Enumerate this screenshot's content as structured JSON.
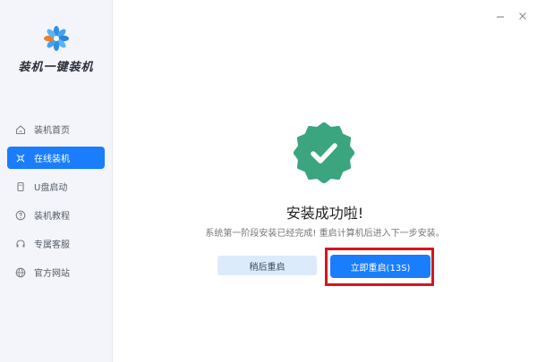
{
  "app": {
    "name": "装机一键装机",
    "brand_color": "#1a7dfb",
    "success_color": "#3aa57f",
    "highlight_color": "#d8141d"
  },
  "window_controls": {
    "minimize_icon": "minimize-icon",
    "close_icon": "close-icon"
  },
  "sidebar": {
    "items": [
      {
        "label": "装机首页",
        "icon": "home-icon",
        "active": false
      },
      {
        "label": "在线装机",
        "icon": "online-install-icon",
        "active": true
      },
      {
        "label": "U盘启动",
        "icon": "usb-icon",
        "active": false
      },
      {
        "label": "装机教程",
        "icon": "help-icon",
        "active": false
      },
      {
        "label": "专属客服",
        "icon": "headset-icon",
        "active": false
      },
      {
        "label": "官方网站",
        "icon": "globe-icon",
        "active": false
      }
    ]
  },
  "main": {
    "status_icon": "success-check-icon",
    "title": "安装成功啦!",
    "subtitle": "系统第一阶段安装已经完成! 重启计算机后进入下一步安装。",
    "restart_later_label": "稍后重启",
    "restart_now_label": "立即重启(13S)"
  }
}
